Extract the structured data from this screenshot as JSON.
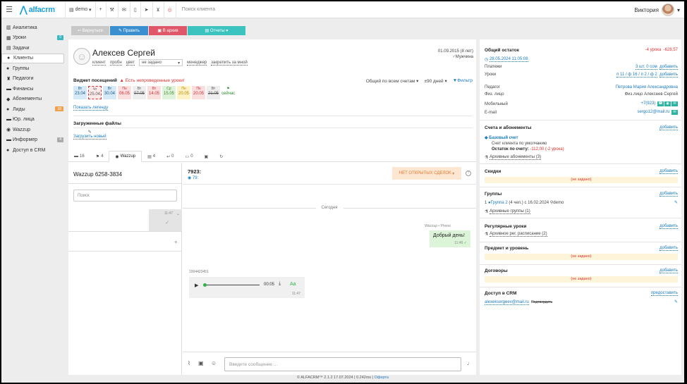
{
  "topbar": {
    "logo": "alfacrm",
    "branch": "demo",
    "search_placeholder": "Поиск клиента",
    "user_name": "Виктория"
  },
  "sidebar": {
    "items": [
      {
        "label": "Аналитика",
        "icon": "chart-icon"
      },
      {
        "label": "Уроки",
        "icon": "calendar-icon",
        "badge": "0"
      },
      {
        "label": "Задачи",
        "icon": "tasks-icon"
      },
      {
        "label": "Клиенты",
        "icon": "user-icon"
      },
      {
        "label": "Группы",
        "icon": "group-icon"
      },
      {
        "label": "Педагоги",
        "icon": "teacher-icon"
      },
      {
        "label": "Финансы",
        "icon": "money-icon"
      },
      {
        "label": "Абонементы",
        "icon": "ticket-icon"
      },
      {
        "label": "Лиды",
        "icon": "lead-icon",
        "badge": "18"
      },
      {
        "label": "Юр. лица",
        "icon": "company-icon"
      },
      {
        "label": "Wazzup",
        "icon": "whatsapp-icon"
      },
      {
        "label": "Информер",
        "icon": "info-icon",
        "badge": "4"
      },
      {
        "label": "Доступ в CRM",
        "icon": "key-icon"
      }
    ]
  },
  "toolbar": {
    "return": "Вернуться",
    "edit": "Править",
    "archive": "В архив",
    "reports": "Отчеты"
  },
  "client": {
    "name": "Алексев Сергей",
    "tag_client": "клиент",
    "tag_lesson": "пробн",
    "tag_color": "цвет",
    "status_value": "не задано",
    "manager_label": "менеджер",
    "assign_me": "закрепить за мной",
    "birthdate": "01.09.2015 (8 лет)",
    "gender": "Мужчина"
  },
  "visits": {
    "title": "Виджет посещений",
    "warning": "Есть непроведенные уроки!",
    "scope": "Общий по всем счетам",
    "period": "±90 дней",
    "filter": "Фильтр",
    "cells": [
      {
        "day": "Вт",
        "date": "23.04",
        "bg": "#d6e9f7",
        "color": "#1a5a8a"
      },
      {
        "day": "Чт",
        "date": "25.04",
        "bg": "#fdeaea",
        "color": "#555"
      },
      {
        "day": "Вт",
        "date": "30.04",
        "bg": "#d6e9f7",
        "color": "#1a5a8a"
      },
      {
        "day": "Пн",
        "date": "06.05",
        "bg": "#fbdede",
        "color": "#c33"
      },
      {
        "day": "Вт",
        "date": "07.05",
        "bg": "#eeeeee",
        "color": "#555"
      },
      {
        "day": "Вт",
        "date": "14.05",
        "bg": "#fbdede",
        "color": "#c33"
      },
      {
        "day": "Ср",
        "date": "15.05",
        "bg": "#dff3da",
        "color": "#3a8a2a"
      },
      {
        "day": "Пн",
        "date": "20.05",
        "bg": "#fdf2c6",
        "color": "#b58a00"
      },
      {
        "day": "Пн",
        "date": "20.05",
        "bg": "#fbdede",
        "color": "#c33"
      },
      {
        "day": "Вт",
        "date": "21.05",
        "bg": "#eeeeee",
        "color": "#555"
      },
      {
        "day": "",
        "date": "сейчас",
        "bg": "#ffffff",
        "color": "#2a8a2a"
      }
    ],
    "legend_link": "Показать легенду"
  },
  "files": {
    "title": "Загруженные файлы",
    "upload": "Загрузить новый"
  },
  "tabs": [
    {
      "label": "16",
      "icon": "comment-icon"
    },
    {
      "label": "4",
      "icon": "flag-icon"
    },
    {
      "label": "Wazzup",
      "icon": "whatsapp-icon",
      "active": true
    },
    {
      "label": "4",
      "icon": "doc-icon"
    },
    {
      "label": "0",
      "icon": "reply-icon"
    },
    {
      "label": "0",
      "icon": "chat-icon"
    },
    {
      "label": "",
      "icon": "card-icon"
    },
    {
      "label": "",
      "icon": "history-icon"
    }
  ],
  "chat": {
    "channel_title": "Wazzup 6258-3834",
    "search_placeholder": "Поиск",
    "item_time": "11:47",
    "phone": "7923:",
    "phone_sub": "79:",
    "no_deals": "НЕТ ОТКРЫТЫХ СДЕЛОК",
    "day_separator": "Сегодня",
    "msg_source": "Wazzup • Phone",
    "msg_text": "Добрый день!",
    "msg_time": "11:46",
    "audio_from": "1004423451",
    "audio_duration": "00:05",
    "audio_aa": "Aa",
    "audio_time": "11:47",
    "input_placeholder": "Введите сообщение ..."
  },
  "right": {
    "balance_title": "Общий остаток",
    "balance_lessons": "-4 урока",
    "balance_amount": "-628,57",
    "balance_date": "28.05.2024 11:05:08",
    "payments_label": "Платежи",
    "payments_value": "3 шт. 0 сом",
    "payments_add": "добавить",
    "lessons_label": "Уроки",
    "lessons_value": "п 11 / ф 16 / п 2 / ф 2",
    "lessons_add": "добавить",
    "teacher_label": "Педагог",
    "teacher_value": "Петрова Мария Александровна",
    "person_label": "Физ. лицо",
    "person_value": "Физ.лицо Алексеев Сергей",
    "mobile_label": "Мобильный",
    "mobile_value": "+7(923)",
    "email_label": "E-mail",
    "email_value": "sergo12@mail.ru",
    "accounts_title": "Счета и абонементы",
    "accounts_add": "добавить",
    "base_account": "Базовый счет",
    "account_desc": "Счет клиента по умолчанию",
    "account_balance_label": "Остаток по счету:",
    "account_balance_value": "-112,00 (-2 урока)",
    "archived_subs": "Архивные абонементы (3)",
    "discounts_title": "Скидки",
    "discounts_add": "добавить",
    "not_set": "(не задано)",
    "groups_title": "Группы",
    "groups_add": "добавить",
    "group_line": "1",
    "group_name": "Группа 2",
    "group_info": "(4 чел.) с 16.02.2024",
    "group_branch": "demo",
    "archived_groups": "Архивные группы (1)",
    "regular_title": "Регулярные уроки",
    "regular_add": "добавить",
    "archived_reg": "Архивное рег. расписание (2)",
    "subject_title": "Предмет и уровень",
    "subject_add": "добавить",
    "contracts_title": "Договоры",
    "contracts_add": "добавить",
    "access_title": "Доступ в CRM",
    "access_give": "предоставить",
    "access_email": "alexeksergeev@mail.ru",
    "access_confirm": "Подтвердить"
  },
  "footer": {
    "copy": "© ALFACRM™ 2.1.2 17.07.2024 | 0.242ms |",
    "link": "Оферта"
  }
}
